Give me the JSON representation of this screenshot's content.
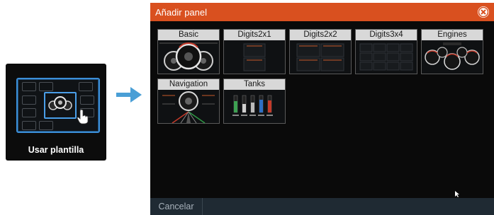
{
  "template_tile": {
    "label": "Usar plantilla"
  },
  "dialog": {
    "title": "Añadir panel",
    "close_icon": "close-circle-icon",
    "panels": [
      {
        "id": "basic",
        "label": "Basic"
      },
      {
        "id": "digits2x1",
        "label": "Digits2x1"
      },
      {
        "id": "digits2x2",
        "label": "Digits2x2"
      },
      {
        "id": "digits3x4",
        "label": "Digits3x4"
      },
      {
        "id": "engines",
        "label": "Engines"
      },
      {
        "id": "navigation",
        "label": "Navigation"
      },
      {
        "id": "tanks",
        "label": "Tanks"
      }
    ],
    "cancel_label": "Cancelar"
  },
  "colors": {
    "header": "#d9501f",
    "accent_blue": "#3c8fd8",
    "background": "#0a0a0a",
    "footer": "#1f2a33"
  }
}
